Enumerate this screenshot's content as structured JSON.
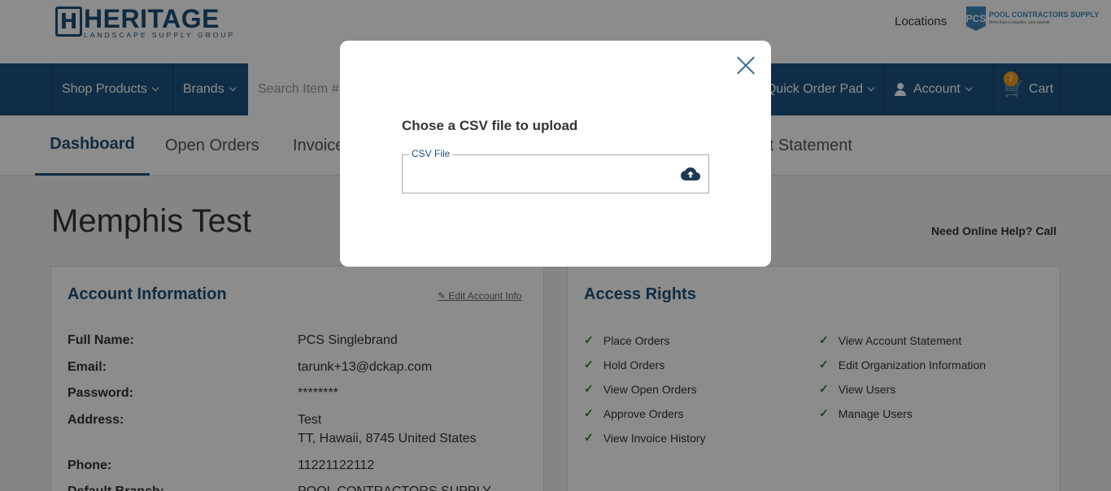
{
  "header": {
    "logo_title": "HERITAGE",
    "logo_subtitle": "LANDSCAPE SUPPLY GROUP",
    "locations_link": "Locations",
    "pcs_logo_line1": "POOL CONTRACTORS SUPPLY",
    "pcs_logo_line2": "More than a supplier, your partner"
  },
  "nav": {
    "shop_products": "Shop Products",
    "brands": "Brands",
    "search_placeholder": "Search Item #",
    "quick_order_pad": "Quick Order Pad",
    "account": "Account",
    "cart_label": "Cart",
    "cart_count": "7"
  },
  "tabs": {
    "dashboard": "Dashboard",
    "open_orders": "Open Orders",
    "invoices": "Invoices",
    "account_statement": "Account Statement"
  },
  "page": {
    "title": "Memphis Test",
    "help_text": "Need Online Help? Call"
  },
  "account_info": {
    "title": "Account Information",
    "edit_link": "Edit Account Info",
    "rows": [
      {
        "label": "Full Name:",
        "value": "PCS Singlebrand"
      },
      {
        "label": "Email:",
        "value": "tarunk+13@dckap.com"
      },
      {
        "label": "Password:",
        "value": "********"
      },
      {
        "label": "Address:",
        "value": "Test",
        "value2": "TT, Hawaii, 8745 United States"
      },
      {
        "label": "Phone:",
        "value": "11221122112"
      },
      {
        "label": "Default Branch:",
        "value": "POOL CONTRACTORS SUPPLY"
      }
    ]
  },
  "access_rights": {
    "title": "Access Rights",
    "left": [
      "Place Orders",
      "Hold Orders",
      "View Open Orders",
      "Approve Orders",
      "View Invoice History"
    ],
    "right": [
      "View Account Statement",
      "Edit Organization Information",
      "View Users",
      "Manage Users"
    ]
  },
  "modal": {
    "title": "Chose a CSV file to upload",
    "field_label": "CSV File"
  },
  "colors": {
    "brand_blue": "#1d5380",
    "accent_orange": "#f29f1b",
    "check_green": "#2e7d32"
  }
}
